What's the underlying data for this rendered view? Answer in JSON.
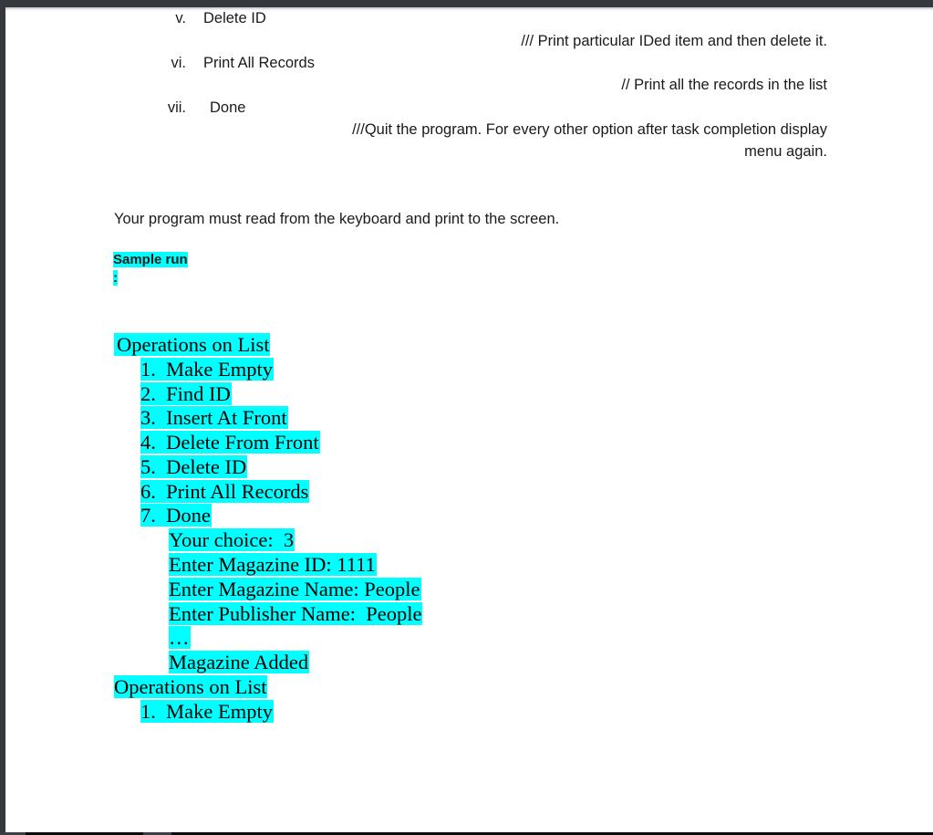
{
  "menu_items": [
    {
      "numeral": "v.",
      "label": "Delete ID",
      "comment": "/// Print particular IDed item and then delete it."
    },
    {
      "numeral": "vi.",
      "label": "Print All Records",
      "comment": "// Print all the records in the list"
    },
    {
      "numeral": "vii.",
      "label": "Done",
      "comment_line1": "///Quit the program. For every other option after task completion display",
      "comment_line2": "menu again."
    }
  ],
  "instruction": "Your program must read from the keyboard and print to the screen.",
  "sample_run": {
    "heading": "Sample run",
    "colon": ":",
    "title": "Operations on List",
    "options": [
      "1.  Make Empty",
      "2.  Find ID",
      "3.  Insert At Front",
      "4.  Delete From Front",
      "5.  Delete ID",
      "6.  Print All Records",
      "7.  Done"
    ],
    "interaction": [
      "Your choice:  3",
      "Enter Magazine ID: 1111",
      "Enter Magazine Name: People",
      "Enter Publisher Name:  People",
      "…",
      "Magazine Added"
    ],
    "repeat_title": "Operations on List",
    "repeat_first_option": "1.  Make Empty"
  },
  "colors": {
    "highlight": "#00ffff",
    "viewer_background": "#35393d",
    "page": "#ffffff"
  }
}
